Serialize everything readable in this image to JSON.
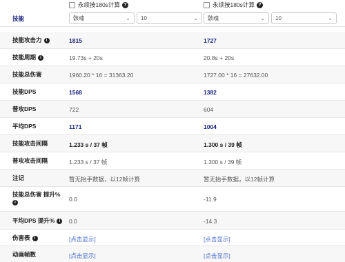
{
  "continuous": {
    "label": "永续按180s计算",
    "help_icon": "?"
  },
  "skill_row": {
    "label": "技能",
    "left": {
      "skill": "骸魂",
      "level": "10"
    },
    "right": {
      "skill": "骸魂",
      "level": "10"
    }
  },
  "rows": [
    {
      "key": "skill_atk",
      "label": "技能攻击力",
      "info": true,
      "left": "1815",
      "right": "1727",
      "style": "navy"
    },
    {
      "key": "skill_period",
      "label": "技能周期",
      "info": true,
      "left": "19.73s + 20s",
      "right": "20.8s + 20s",
      "style": "plain"
    },
    {
      "key": "skill_total",
      "label": "技能总伤害",
      "info": false,
      "left": "1960.20 * 16 = 31363.20",
      "right": "1727.00 * 16 = 27632.00",
      "style": "plain"
    },
    {
      "key": "skill_dps",
      "label": "技能DPS",
      "info": false,
      "left": "1568",
      "right": "1382",
      "style": "navy"
    },
    {
      "key": "normal_dps",
      "label": "普攻DPS",
      "info": false,
      "left": "722",
      "right": "604",
      "style": "plain"
    },
    {
      "key": "avg_dps",
      "label": "平均DPS",
      "info": false,
      "left": "1171",
      "right": "1004",
      "style": "navy"
    },
    {
      "key": "skill_atk_interval",
      "label": "技能攻击间隔",
      "info": false,
      "left": "1.233 s / 37 帧",
      "right": "1.300 s / 39 帧",
      "style": "bold"
    },
    {
      "key": "normal_atk_interval",
      "label": "普攻攻击间隔",
      "info": false,
      "left": "1.233 s / 37 帧",
      "right": "1.300 s / 39 帧",
      "style": "plain"
    },
    {
      "key": "notes",
      "label": "注记",
      "info": false,
      "left": "暂无抬手数据，以12帧计算",
      "right": "暂无抬手数据，以12帧计算",
      "style": "plain"
    }
  ],
  "improve_total": {
    "label": "技能总伤害 提升%",
    "left": "0.0",
    "right": "-11.9"
  },
  "improve_dps": {
    "label": "平均DPS 提升%",
    "left": "0.0",
    "right": "-14.3"
  },
  "damage_table": {
    "label": "伤害表",
    "left": "[点击显示]",
    "right": "[点击显示]"
  },
  "anim_frames": {
    "label": "动画帧数",
    "left": "[点击显示]",
    "right": "[点击显示]"
  },
  "info_glyph": "i"
}
